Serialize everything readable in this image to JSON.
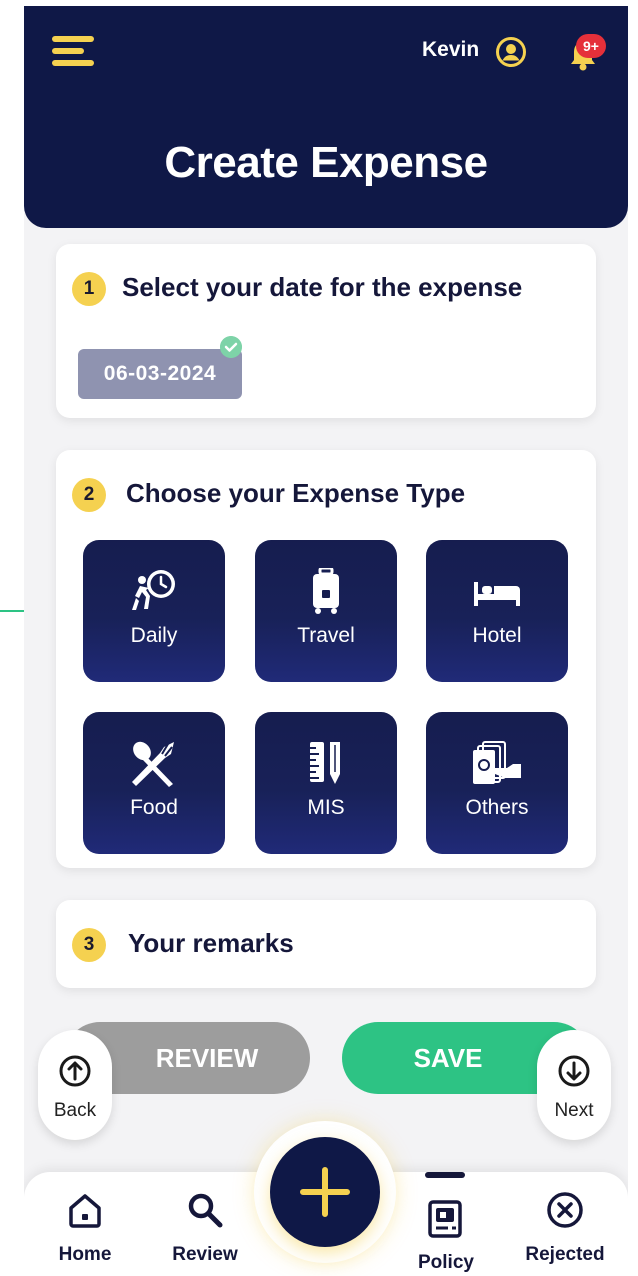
{
  "header": {
    "user_name": "Kevin",
    "notification_badge": "9+",
    "title": "Create Expense"
  },
  "steps": [
    {
      "number": "1",
      "title": "Select your date for the expense"
    },
    {
      "number": "2",
      "title": "Choose your Expense Type"
    },
    {
      "number": "3",
      "title": "Your remarks"
    }
  ],
  "date": {
    "value": "06-03-2024"
  },
  "expense_types": [
    {
      "label": "Daily",
      "icon": "clock-walker-icon"
    },
    {
      "label": "Travel",
      "icon": "luggage-icon"
    },
    {
      "label": "Hotel",
      "icon": "bed-icon"
    },
    {
      "label": "Food",
      "icon": "fork-spoon-icon"
    },
    {
      "label": "MIS",
      "icon": "ruler-pencil-icon"
    },
    {
      "label": "Others",
      "icon": "cash-icon"
    }
  ],
  "actions": {
    "review_label": "REVIEW",
    "save_label": "SAVE",
    "back_label": "Back",
    "next_label": "Next"
  },
  "tabbar": {
    "home": "Home",
    "review": "Review",
    "policy": "Policy",
    "rejected": "Rejected"
  },
  "colors": {
    "header_bg": "#0f1847",
    "accent_yellow": "#f5d150",
    "save_green": "#2dc384",
    "review_grey": "#9d9d9d",
    "badge_red": "#e5303a"
  }
}
